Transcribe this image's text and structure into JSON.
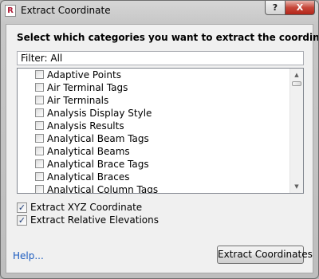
{
  "window": {
    "title": "Extract Coordinate",
    "app_icon_letter": "R",
    "help_button": "?",
    "close_button": "X"
  },
  "dialog": {
    "instruction": "Select which categories you want to extract the coordinates:",
    "filter_text": "Filter: All",
    "categories": [
      {
        "label": "Adaptive Points",
        "checked": false
      },
      {
        "label": "Air Terminal Tags",
        "checked": false
      },
      {
        "label": "Air Terminals",
        "checked": false
      },
      {
        "label": "Analysis Display Style",
        "checked": false
      },
      {
        "label": "Analysis Results",
        "checked": false
      },
      {
        "label": "Analytical Beam Tags",
        "checked": false
      },
      {
        "label": "Analytical Beams",
        "checked": false
      },
      {
        "label": "Analytical Brace Tags",
        "checked": false
      },
      {
        "label": "Analytical Braces",
        "checked": false
      },
      {
        "label": "Analytical Column Tags",
        "checked": false
      }
    ],
    "options": [
      {
        "label": "Extract XYZ Coordinate",
        "checked": true
      },
      {
        "label": "Extract Relative Elevations",
        "checked": true
      }
    ],
    "help_link": "Help...",
    "extract_button": "Extract Coordinates"
  },
  "colors": {
    "link": "#1b5bbf",
    "close_button": "#c7473a"
  },
  "icons": {
    "scroll_up": "triangle-up",
    "scroll_down": "triangle-down",
    "check": "checkmark"
  }
}
